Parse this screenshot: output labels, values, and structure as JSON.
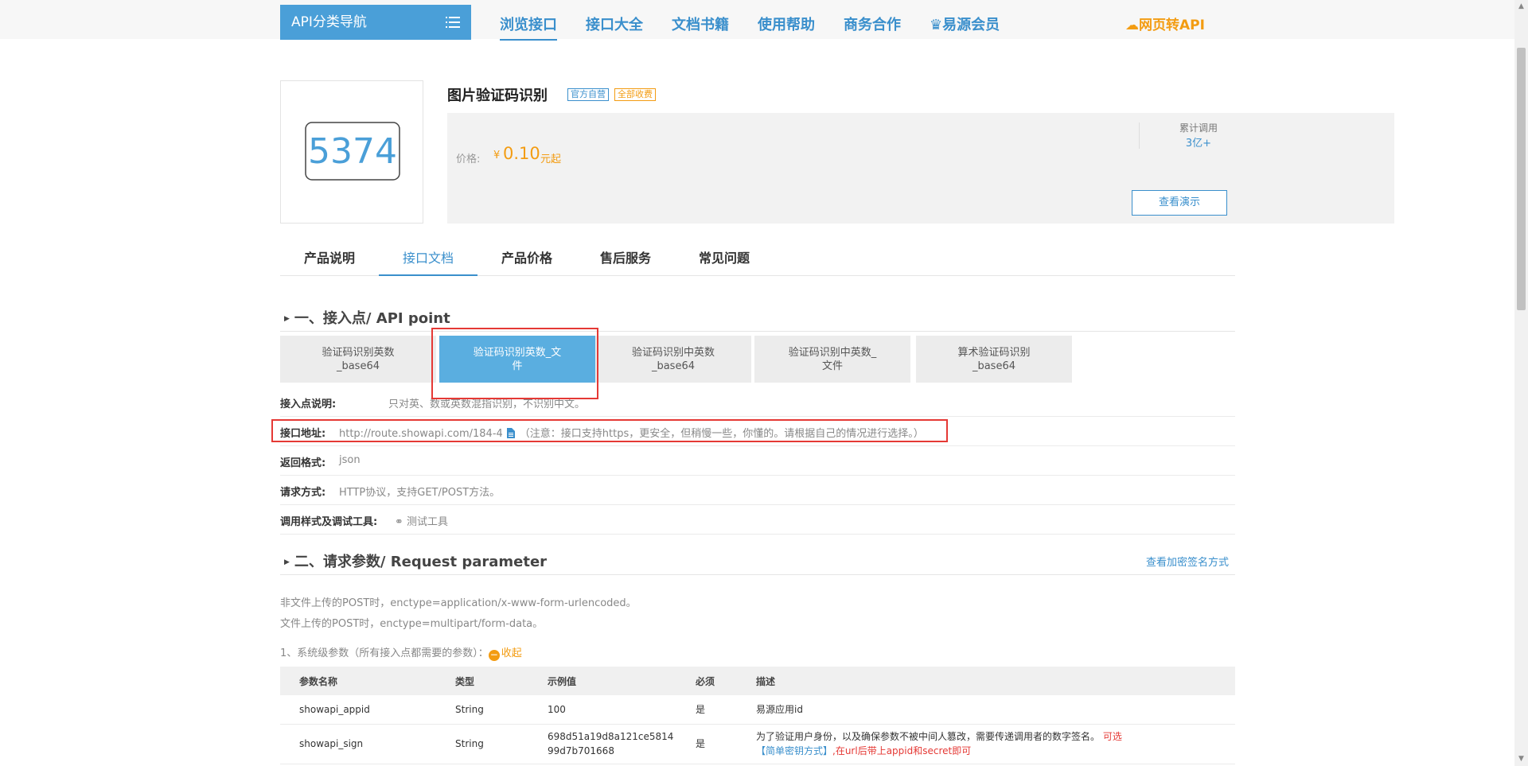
{
  "nav": {
    "category_button": "API分类导航",
    "items": [
      "浏览接口",
      "接口大全",
      "文档书籍",
      "使用帮助",
      "商务合作",
      "易源会员"
    ],
    "promo": "网页转API"
  },
  "product": {
    "image_text": "5374",
    "title": "图片验证码识别",
    "tags": [
      "官方自营",
      "全部收费"
    ],
    "price_label": "价格:",
    "price_currency": "¥",
    "price_value": "0.10",
    "price_unit": "元起",
    "calls_label": "累计调用",
    "calls_value": "3亿+",
    "demo_button": "查看演示"
  },
  "tabs": [
    "产品说明",
    "接口文档",
    "产品价格",
    "售后服务",
    "常见问题"
  ],
  "section1": {
    "title": "一、接入点/ API point",
    "endpoints": [
      {
        "line1": "验证码识别英数",
        "line2": "_base64"
      },
      {
        "line1": "验证码识别英数_文",
        "line2": "件"
      },
      {
        "line1": "验证码识别中英数",
        "line2": "_base64"
      },
      {
        "line1": "验证码识别中英数_",
        "line2": "文件"
      },
      {
        "line1": "算术验证码识别",
        "line2": "_base64"
      }
    ],
    "desc_label": "接入点说明:",
    "desc_value": "只对英、数或英数混指识别，不识别中文。",
    "url_label": "接口地址:",
    "url_value": "http://route.showapi.com/184-4",
    "url_note": "（注意：接口支持https，更安全，但稍慢一些，你懂的。请根据自己的情况进行选择。）",
    "format_label": "返回格式:",
    "format_value": "json",
    "method_label": "请求方式:",
    "method_value": "HTTP协议，支持GET/POST方法。",
    "tool_label": "调用样式及调试工具:",
    "tool_link": "测试工具"
  },
  "section2": {
    "title": "二、请求参数/ Request parameter",
    "sign_link": "查看加密签名方式",
    "note1": "非文件上传的POST时，enctype=application/x-www-form-urlencoded。",
    "note2": "文件上传的POST时，enctype=multipart/form-data。",
    "sys_params_label": "1、系统级参数（所有接入点都需要的参数）：",
    "collapse_label": "收起",
    "table": {
      "headers": [
        "参数名称",
        "类型",
        "示例值",
        "必须",
        "描述"
      ],
      "rows": [
        {
          "name": "showapi_appid",
          "type": "String",
          "example": "100",
          "required": "是",
          "desc": "易源应用id"
        },
        {
          "name": "showapi_sign",
          "type": "String",
          "example1": "698d51a19d8a121ce5814",
          "example2": "99d7b701668",
          "required": "是",
          "desc": "为了验证用户身份，以及确保参数不被中间人篡改，需要传递调用者的数字签名。",
          "desc_optional": "可选",
          "desc_link": "【简单密钥方式】",
          "desc_tail": ",在url后带上appid和secret即可"
        }
      ]
    }
  },
  "colors": {
    "accent": "#3a8fcc",
    "orange": "#f39c12",
    "highlight": "#e53935"
  }
}
